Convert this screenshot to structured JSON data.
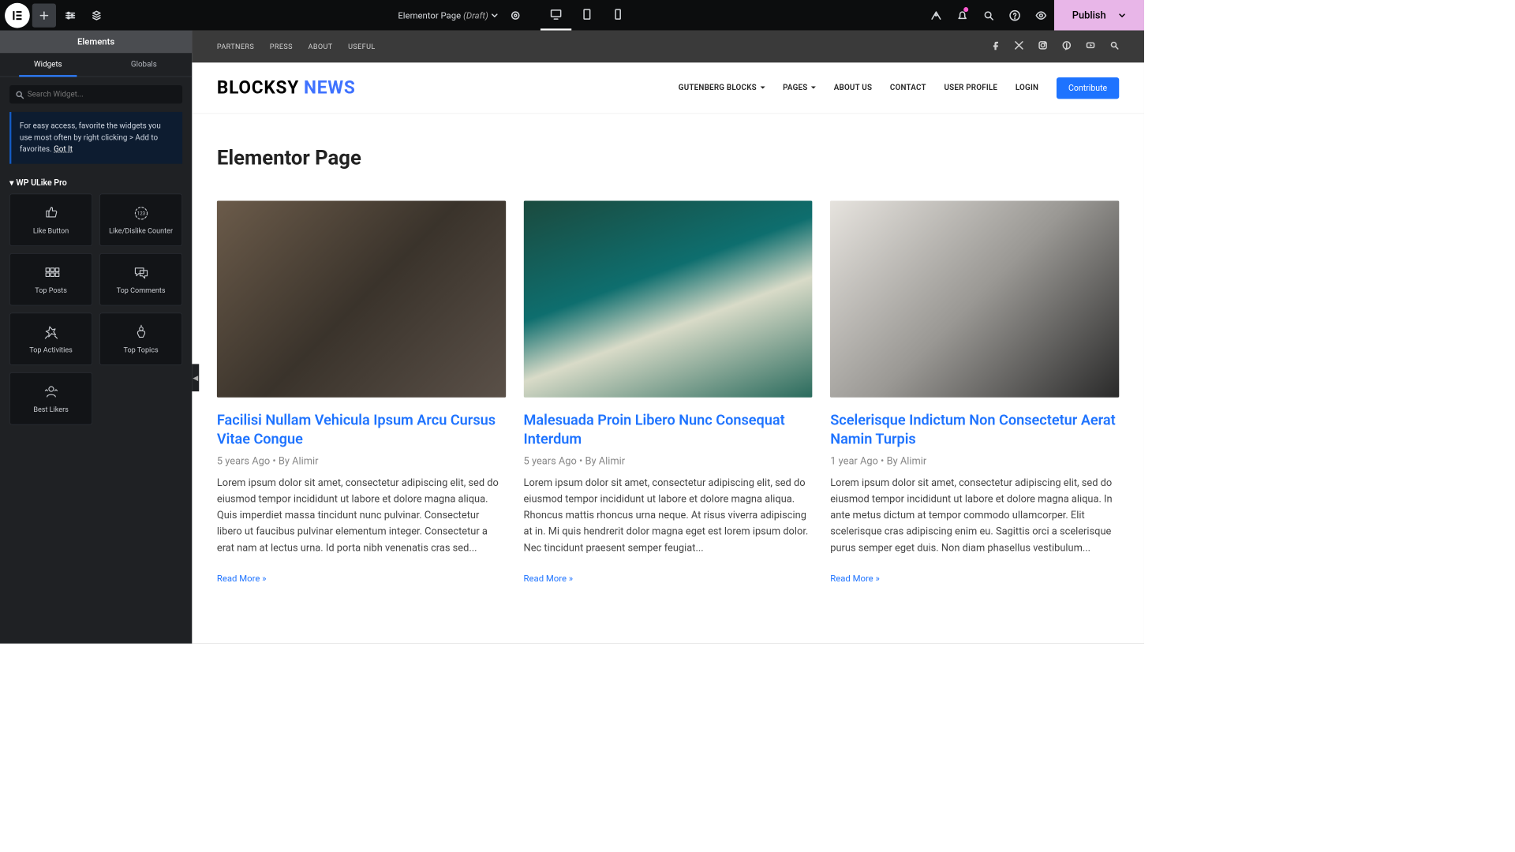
{
  "topbar": {
    "docTitle": "Elementor Page",
    "docStatus": "(Draft)",
    "publish": "Publish"
  },
  "sidebar": {
    "header": "Elements",
    "tabs": {
      "widgets": "Widgets",
      "globals": "Globals"
    },
    "searchPlaceholder": "Search Widget...",
    "hintText": "For easy access, favorite the widgets you use most often by right clicking > Add to favorites.",
    "hintGotIt": "Got It",
    "category": "WP ULike Pro",
    "widgets": [
      {
        "label": "Like Button"
      },
      {
        "label": "Like/Dislike Counter"
      },
      {
        "label": "Top Posts"
      },
      {
        "label": "Top Comments"
      },
      {
        "label": "Top Activities"
      },
      {
        "label": "Top Topics"
      },
      {
        "label": "Best Likers"
      }
    ]
  },
  "preview": {
    "topnav": [
      "PARTNERS",
      "PRESS",
      "ABOUT",
      "USEFUL"
    ],
    "brand": {
      "a": "BLOCKSY",
      "b": "NEWS"
    },
    "nav": [
      {
        "label": "GUTENBERG BLOCKS",
        "dd": true
      },
      {
        "label": "PAGES",
        "dd": true
      },
      {
        "label": "ABOUT US"
      },
      {
        "label": "CONTACT"
      },
      {
        "label": "USER PROFILE"
      },
      {
        "label": "LOGIN"
      }
    ],
    "contribute": "Contribute",
    "pageTitle": "Elementor Page",
    "posts": [
      {
        "title": "Facilisi Nullam Vehicula Ipsum Arcu Cursus Vitae Congue",
        "date": "5 years Ago",
        "by": "By Alimir",
        "excerpt": "Lorem ipsum dolor sit amet, consectetur adipiscing elit, sed do eiusmod tempor incididunt ut labore et dolore magna aliqua. Quis imperdiet massa tincidunt nunc pulvinar. Consectetur libero ut faucibus pulvinar elementum integer. Consectetur a erat nam at lectus urna. Id porta nibh venenatis cras sed...",
        "readmore": "Read More »"
      },
      {
        "title": "Malesuada Proin Libero Nunc Consequat Interdum",
        "date": "5 years Ago",
        "by": "By Alimir",
        "excerpt": "Lorem ipsum dolor sit amet, consectetur adipiscing elit, sed do eiusmod tempor incididunt ut labore et dolore magna aliqua. Rhoncus mattis rhoncus urna neque. At risus viverra adipiscing at in. Mi quis hendrerit dolor magna eget est lorem ipsum dolor. Nec tincidunt praesent semper feugiat...",
        "readmore": "Read More »"
      },
      {
        "title": "Scelerisque Indictum Non Consectetur Aerat Namin Turpis",
        "date": "1 year Ago",
        "by": "By Alimir",
        "excerpt": "Lorem ipsum dolor sit amet, consectetur adipiscing elit, sed do eiusmod tempor incididunt ut labore et dolore magna aliqua. In ante metus dictum at tempor commodo ullamcorper. Elit scelerisque cras adipiscing enim eu. Sagittis orci a scelerisque purus semper eget duis. Non diam phasellus vestibulum...",
        "readmore": "Read More »"
      }
    ]
  }
}
